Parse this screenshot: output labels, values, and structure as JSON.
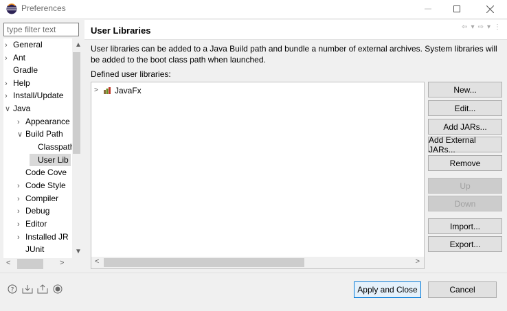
{
  "window": {
    "title": "Preferences"
  },
  "filter": {
    "placeholder": "type filter text"
  },
  "tree": [
    {
      "label": "General",
      "arrow": ">"
    },
    {
      "label": "Ant",
      "arrow": ">"
    },
    {
      "label": "Gradle",
      "arrow": ""
    },
    {
      "label": "Help",
      "arrow": ">"
    },
    {
      "label": "Install/Update",
      "arrow": ">"
    },
    {
      "label": "Java",
      "arrow": "v"
    },
    {
      "label": "Appearance",
      "arrow": ">"
    },
    {
      "label": "Build Path",
      "arrow": "v"
    },
    {
      "label": "Classpath",
      "arrow": ""
    },
    {
      "label": "User Lib",
      "arrow": ""
    },
    {
      "label": "Code Cove",
      "arrow": ""
    },
    {
      "label": "Code Style",
      "arrow": ">"
    },
    {
      "label": "Compiler",
      "arrow": ">"
    },
    {
      "label": "Debug",
      "arrow": ">"
    },
    {
      "label": "Editor",
      "arrow": ">"
    },
    {
      "label": "Installed JR",
      "arrow": ">"
    },
    {
      "label": "JUnit",
      "arrow": ""
    }
  ],
  "content": {
    "heading": "User Libraries",
    "description": "User libraries can be added to a Java Build path and bundle a number of external archives. System libraries will be added to the boot class path when launched.",
    "defined_label": "Defined user libraries:",
    "libraries": [
      {
        "name": "JavaFx"
      }
    ]
  },
  "buttons": {
    "new": "New...",
    "edit": "Edit...",
    "add_jars": "Add JARs...",
    "add_external_jars": "Add External JARs...",
    "remove": "Remove",
    "up": "Up",
    "down": "Down",
    "import": "Import...",
    "export": "Export..."
  },
  "footer": {
    "apply_close": "Apply and Close",
    "cancel": "Cancel"
  }
}
